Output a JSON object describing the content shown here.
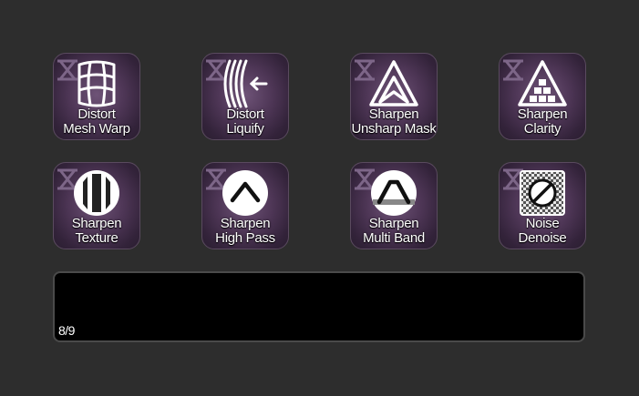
{
  "buttons": [
    {
      "line1": "Distort",
      "line2": "Mesh Warp",
      "icon": "mesh-warp-icon"
    },
    {
      "line1": "Distort",
      "line2": "Liquify",
      "icon": "liquify-icon"
    },
    {
      "line1": "Sharpen",
      "line2": "Unsharp Mask",
      "icon": "unsharp-mask-icon"
    },
    {
      "line1": "Sharpen",
      "line2": "Clarity",
      "icon": "clarity-icon"
    },
    {
      "line1": "Sharpen",
      "line2": "Texture",
      "icon": "texture-icon"
    },
    {
      "line1": "Sharpen",
      "line2": "High Pass",
      "icon": "high-pass-icon"
    },
    {
      "line1": "Sharpen",
      "line2": "Multi Band",
      "icon": "multi-band-icon"
    },
    {
      "line1": "Noise",
      "line2": "Denoise",
      "icon": "denoise-icon"
    }
  ],
  "display": {
    "page_indicator": "8/9"
  },
  "colors": {
    "background": "#2d2d2d",
    "button_purple": "#6e5377",
    "display": "#000000"
  }
}
